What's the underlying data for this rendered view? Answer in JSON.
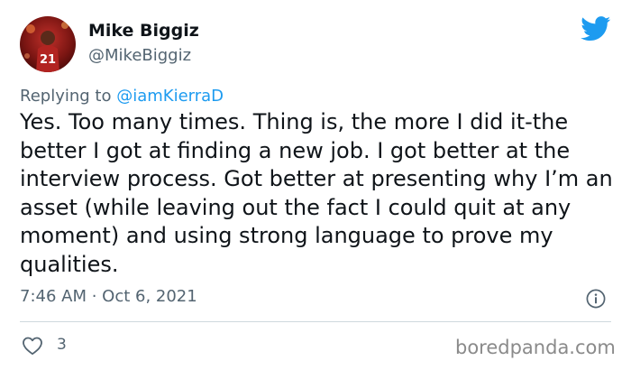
{
  "author": {
    "display_name": "Mike Biggiz",
    "handle": "@MikeBiggiz",
    "avatar_jersey_number": "21"
  },
  "reply": {
    "prefix": "Replying to ",
    "mention": "@iamKierraD"
  },
  "tweet": {
    "text": "Yes. Too many times. Thing is, the more I did it-the better I got at finding a new job. I got better at the interview process. Got better at presenting why I’m an asset (while leaving out the fact I could quit at any moment) and using strong language to prove my qualities.",
    "timestamp": "7:46 AM · Oct 6, 2021"
  },
  "engagement": {
    "likes": "3"
  },
  "watermark": "boredpanda.com",
  "colors": {
    "twitter_blue": "#1d9bf0",
    "secondary_text": "#536471",
    "primary_text": "#0f1419"
  },
  "icons": {
    "brand": "twitter-bird-icon",
    "info": "info-icon",
    "like": "heart-icon"
  }
}
